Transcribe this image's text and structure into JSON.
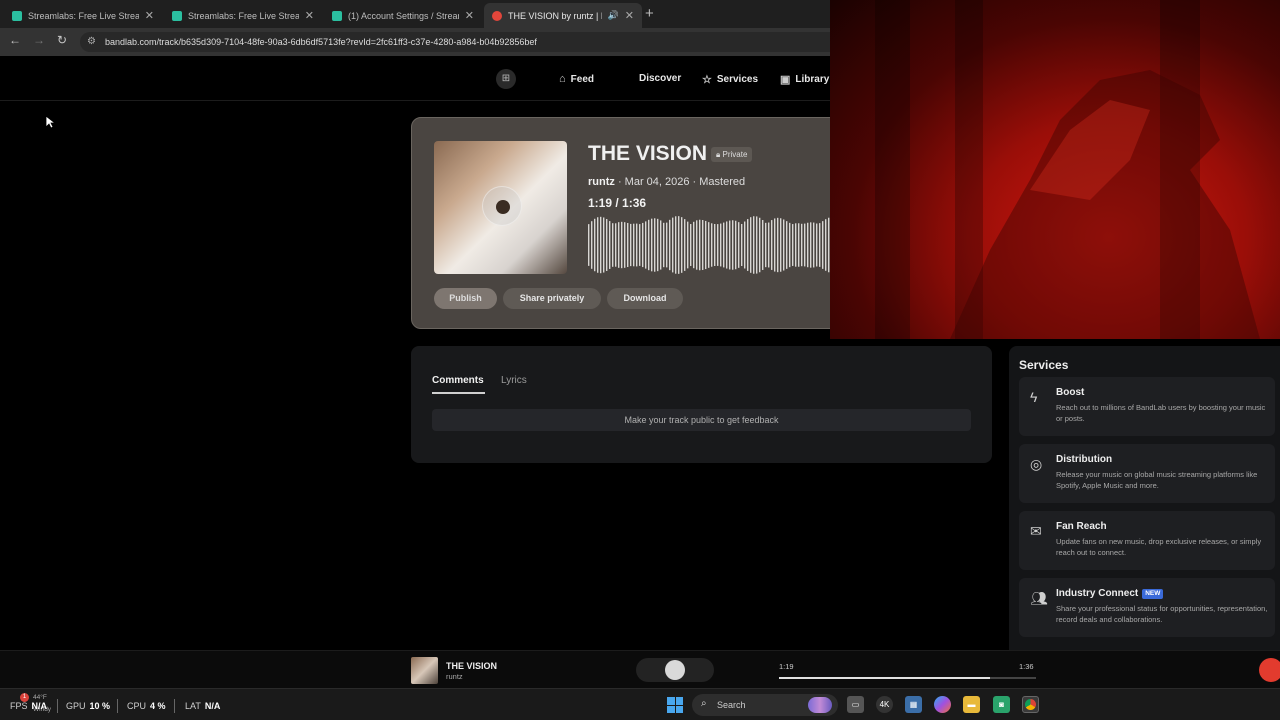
{
  "browser": {
    "tabs": [
      {
        "label": "Streamlabs: Free Live Streaming",
        "active": false,
        "favicon_color": "#2bbfa0"
      },
      {
        "label": "Streamlabs: Free Live Streaming",
        "active": false,
        "favicon_color": "#2bbfa0"
      },
      {
        "label": "(1) Account Settings / Streamlab",
        "active": false,
        "favicon_color": "#2bbfa0"
      },
      {
        "label": "THE VISION by runtz | Band",
        "active": true,
        "favicon_color": "#e2463b"
      }
    ],
    "url": "bandlab.com/track/b635d309-7104-48fe-90a3-6db6df5713fe?revId=2fc61ff3-c37e-4280-a984-b04b92856bef"
  },
  "nav": {
    "items": [
      {
        "label": "Feed",
        "icon": "home-icon"
      },
      {
        "label": "Discover",
        "icon": ""
      },
      {
        "label": "Services",
        "icon": "star-icon"
      },
      {
        "label": "Library",
        "icon": "library-icon"
      }
    ]
  },
  "track": {
    "title": "THE VISION",
    "privacy": "Private",
    "artist": "runtz",
    "meta": " · Mar 04, 2026 · Mastered",
    "current_time": "1:19",
    "separator": " / ",
    "duration": "1:36",
    "buttons": {
      "publish": "Publish",
      "share": "Share privately",
      "download": "Download"
    }
  },
  "comments": {
    "tabs": {
      "comments": "Comments",
      "lyrics": "Lyrics"
    },
    "active_tab": "Comments",
    "notice": "Make your track public to get feedback"
  },
  "services": {
    "title": "Services",
    "items": [
      {
        "title": "Boost",
        "icon": "bolt-icon",
        "desc": "Reach out to millions of BandLab users by boosting your music or posts."
      },
      {
        "title": "Distribution",
        "icon": "distribution-icon",
        "desc": "Release your music on global music streaming platforms like Spotify, Apple Music and more."
      },
      {
        "title": "Fan Reach",
        "icon": "mail-icon",
        "desc": "Update fans on new music, drop exclusive releases, or simply reach out to connect."
      },
      {
        "title": "Industry Connect",
        "icon": "people-icon",
        "badge": "NEW",
        "desc": "Share your professional status for opportunities, representation, record deals and collaborations."
      }
    ]
  },
  "player": {
    "title": "THE VISION",
    "artist": "runtz",
    "current_time": "1:19",
    "duration": "1:36",
    "progress": 0.82
  },
  "taskbar": {
    "stats": {
      "fps_label": "FPS",
      "fps_value": "N/A",
      "gpu_label": "GPU",
      "gpu_value": "10 %",
      "cpu_label": "CPU",
      "cpu_value": "4 %",
      "lat_label": "LAT",
      "lat_value": "N/A"
    },
    "weather": {
      "badge": "1",
      "temp": "44°F",
      "condition": "Windy"
    },
    "search_label": "Search"
  },
  "colors": {
    "accent_record": "#e23b2e",
    "new_badge": "#3a6ad9",
    "video_red": "#d11810"
  }
}
